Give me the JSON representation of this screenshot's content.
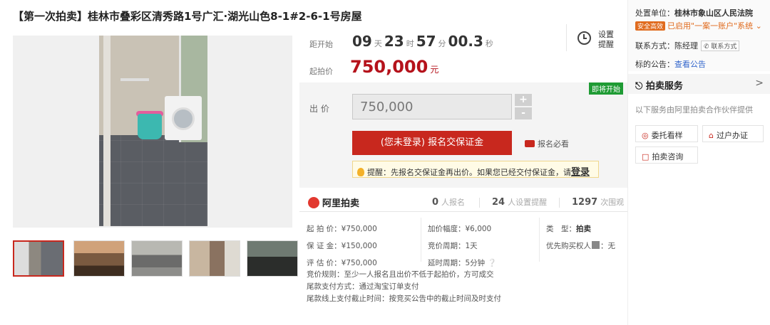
{
  "title": "【第一次拍卖】桂林市叠彩区清秀路1号广汇·湖光山色8-1#2-6-1号房屋",
  "timer": {
    "label": "距开始",
    "days": "09",
    "days_unit": "天",
    "hours": "23",
    "hours_unit": "时",
    "minutes": "57",
    "minutes_unit": "分",
    "seconds": "00.3",
    "seconds_unit": "秒",
    "reminder_label_1": "设置",
    "reminder_label_2": "提醒"
  },
  "start_price": {
    "label": "起拍价",
    "value": "750,000",
    "unit": "元"
  },
  "bid": {
    "badge": "即将开始",
    "label": "出 价",
    "input_value": "750,000",
    "plus": "+",
    "minus": "-",
    "signup_button": "(您未登录) 报名交保证金",
    "must_read": "报名必看",
    "tip_prefix": "提醒：先报名交保证金再出价。如果您已经交付保证金，请",
    "tip_login": "登录"
  },
  "stats": {
    "brand": "阿里拍卖",
    "signups_count": "0",
    "signups_label": "人报名",
    "reminders_count": "24",
    "reminders_label": "人设置提醒",
    "views_count": "1297",
    "views_label": "次围观"
  },
  "info": {
    "start_price": "起 拍 价：¥750,000",
    "deposit": "保 证 金：¥150,000",
    "appraisal": "评 估 价：¥750,000",
    "increment": "加价幅度：¥6,000",
    "cycle": "竞价周期：1天",
    "delay": "延时周期：5分钟",
    "type_label": "类　型：",
    "type_value": "拍卖",
    "priority": "优先购买权人",
    "priority_value": "：无"
  },
  "rules": {
    "line1": "竞价规则：至少一人报名且出价不低于起拍价，方可成交",
    "line2": "尾款支付方式：通过淘宝订单支付",
    "line3": "尾款线上支付截止时间：按竞买公告中的截止时间及时支付"
  },
  "right": {
    "court_label": "处置单位：",
    "court_name": "桂林市象山区人民法院",
    "safe_badge": "安全高效",
    "account_text": "已启用\"一案一账户\"系统",
    "contact_label": "联系方式：陈经理",
    "contact_button": "联系方式",
    "notice_label": "标的公告：",
    "notice_link": "查看公告",
    "service_title": "拍卖服务",
    "service_chevron": ">",
    "service_sub": "以下服务由阿里拍卖合作伙伴提供",
    "service_1": "委托看样",
    "service_2": "过户办证",
    "service_3": "拍卖咨询"
  },
  "colors": {
    "accent_red": "#c8281e",
    "price_red": "#b5121b",
    "badge_green": "#1f9b34"
  }
}
